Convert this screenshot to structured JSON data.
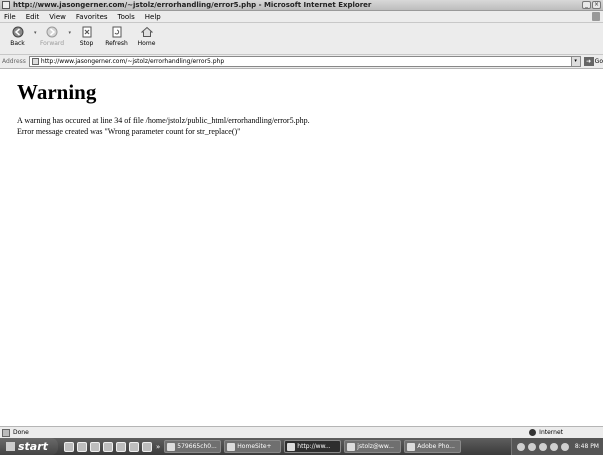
{
  "window": {
    "title": "http://www.jasongerner.com/~jstolz/errorhandling/error5.php - Microsoft Internet Explorer"
  },
  "menu": [
    "File",
    "Edit",
    "View",
    "Favorites",
    "Tools",
    "Help"
  ],
  "toolbar": {
    "back": "Back",
    "forward": "Forward",
    "stop": "Stop",
    "refresh": "Refresh",
    "home": "Home"
  },
  "address": {
    "label": "Address",
    "value": "http://www.jasongerner.com/~jstolz/errorhandling/error5.php",
    "go": "Go"
  },
  "page": {
    "heading": "Warning",
    "line1": "A warning has occured at line 34 of file /home/jstolz/public_html/errorhandling/error5.php.",
    "line2": "Error message created was \"Wrong parameter count for str_replace()\""
  },
  "status": {
    "text": "Done",
    "zone": "Internet"
  },
  "taskbar": {
    "start": "start",
    "overflow": "»",
    "tasks": [
      "579665ch0...",
      "HomeSite+",
      "http://ww...",
      "jstolz@ww...",
      "Adobe Pho..."
    ],
    "clock": "8:48 PM"
  }
}
